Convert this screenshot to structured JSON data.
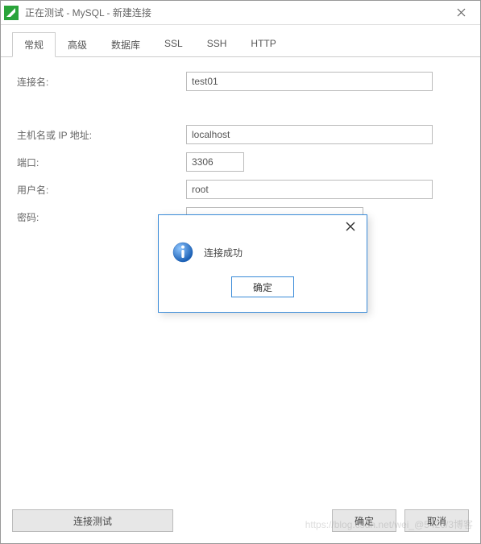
{
  "window": {
    "title": "正在测试 - MySQL - 新建连接"
  },
  "tabs": [
    {
      "label": "常规",
      "active": true
    },
    {
      "label": "高级",
      "active": false
    },
    {
      "label": "数据库",
      "active": false
    },
    {
      "label": "SSL",
      "active": false
    },
    {
      "label": "SSH",
      "active": false
    },
    {
      "label": "HTTP",
      "active": false
    }
  ],
  "form": {
    "connection_name_label": "连接名:",
    "connection_name_value": "test01",
    "host_label": "主机名或 IP 地址:",
    "host_value": "localhost",
    "port_label": "端口:",
    "port_value": "3306",
    "username_label": "用户名:",
    "username_value": "root",
    "password_label": "密码:",
    "password_value": "••••••"
  },
  "footer": {
    "test_label": "连接测试",
    "ok_label": "确定",
    "cancel_label": "取消"
  },
  "modal": {
    "message": "连接成功",
    "ok_label": "确定"
  },
  "watermark": "https://blog.csdn.net/wei_@5420/3博客"
}
